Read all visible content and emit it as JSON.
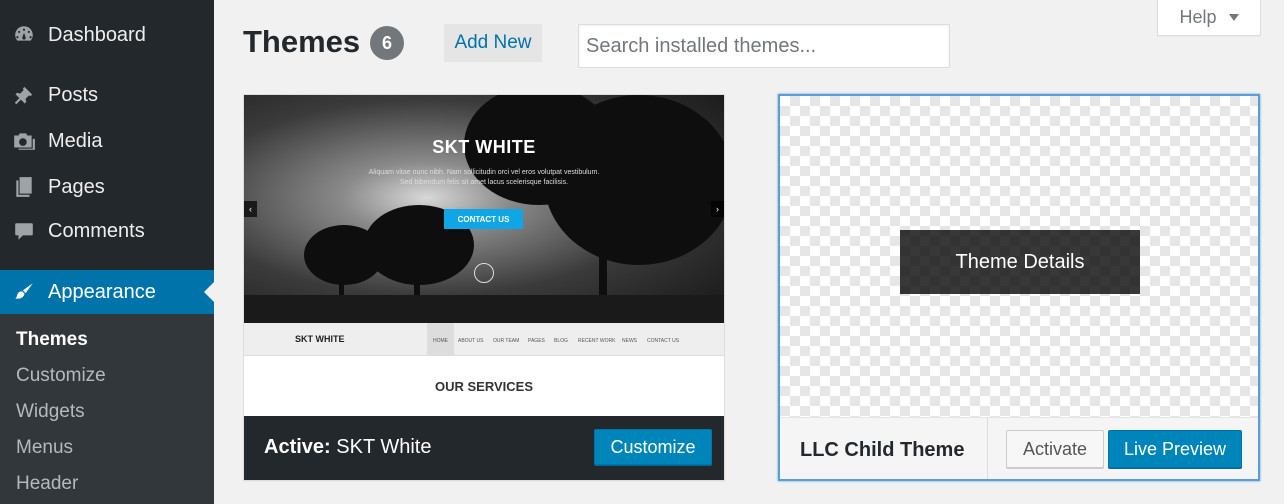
{
  "sidebar": {
    "items": [
      {
        "label": "Dashboard",
        "icon": "dashboard-icon"
      },
      {
        "label": "Posts",
        "icon": "pin-icon"
      },
      {
        "label": "Media",
        "icon": "media-icon"
      },
      {
        "label": "Pages",
        "icon": "pages-icon"
      },
      {
        "label": "Comments",
        "icon": "comment-icon"
      },
      {
        "label": "Appearance",
        "icon": "brush-icon",
        "active": true
      }
    ],
    "submenu": [
      "Themes",
      "Customize",
      "Widgets",
      "Menus",
      "Header"
    ],
    "current_submenu": "Themes"
  },
  "header": {
    "title": "Themes",
    "count": "6",
    "add_new_label": "Add New",
    "search_placeholder": "Search installed themes...",
    "help_label": "Help"
  },
  "active_theme": {
    "screenshot": {
      "title": "SKT WHITE",
      "line1": "Aliquam vitae nunc nibh. Nam sollicitudin orci vel eros volutpat vestibulum.",
      "line2": "Sed bibendum felis sit amet lacus scelerisque facilisis.",
      "button": "CONTACT US",
      "nav_logo": "SKT WHITE",
      "nav_links": [
        "HOME",
        "ABOUT US",
        "OUR TEAM",
        "PAGES",
        "BLOG",
        "RECENT WORK",
        "NEWS",
        "CONTACT US"
      ],
      "section_title": "OUR SERVICES"
    },
    "active_prefix": "Active:",
    "name": "SKT White",
    "customize_label": "Customize"
  },
  "other_theme": {
    "details_label": "Theme Details",
    "name": "LLC Child Theme",
    "activate_label": "Activate",
    "live_preview_label": "Live Preview"
  },
  "colors": {
    "sidebar_bg": "#23282d",
    "accent": "#0073aa",
    "primary_button": "#0085ba"
  }
}
